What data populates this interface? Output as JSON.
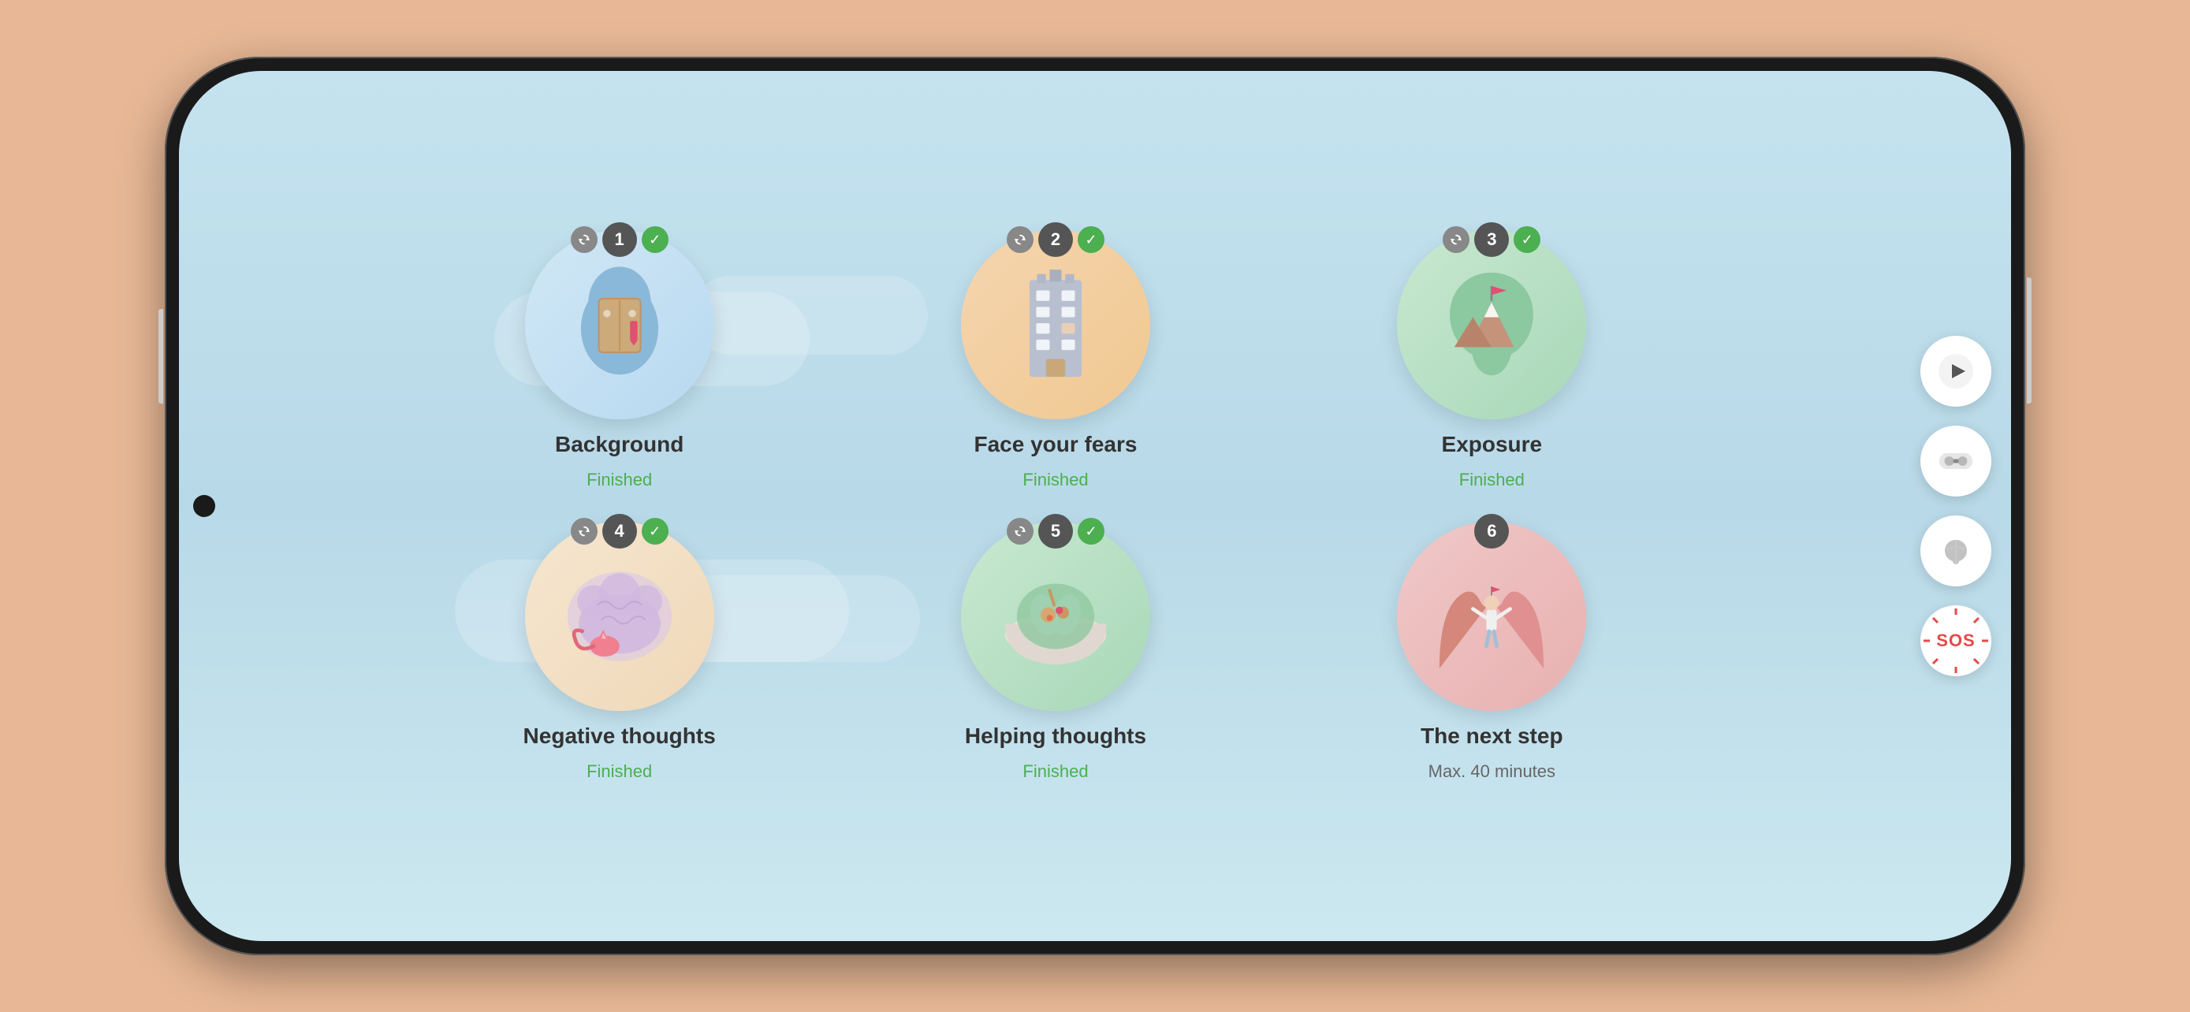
{
  "phone": {
    "background": "#e8b896"
  },
  "modules": [
    {
      "id": 1,
      "number": "1",
      "title": "Background",
      "status": "Finished",
      "statusType": "finished",
      "hasRefresh": true,
      "hasCheck": true,
      "iconType": "head-book",
      "bgType": "blue"
    },
    {
      "id": 2,
      "number": "2",
      "title": "Face your fears",
      "status": "Finished",
      "statusType": "finished",
      "hasRefresh": true,
      "hasCheck": true,
      "iconType": "building",
      "bgType": "orange-bg"
    },
    {
      "id": 3,
      "number": "3",
      "title": "Exposure",
      "status": "Finished",
      "statusType": "finished",
      "hasRefresh": true,
      "hasCheck": true,
      "iconType": "mountain-flag",
      "bgType": "green"
    },
    {
      "id": 4,
      "number": "4",
      "title": "Negative thoughts",
      "status": "Finished",
      "statusType": "finished",
      "hasRefresh": true,
      "hasCheck": true,
      "iconType": "brain-cat",
      "bgType": "beige"
    },
    {
      "id": 5,
      "number": "5",
      "title": "Helping thoughts",
      "status": "Finished",
      "statusType": "finished",
      "hasRefresh": true,
      "hasCheck": true,
      "iconType": "bowl",
      "bgType": "green"
    },
    {
      "id": 6,
      "number": "6",
      "title": "The next step",
      "status": "Max. 40 minutes",
      "statusType": "time",
      "hasRefresh": false,
      "hasCheck": false,
      "iconType": "climber",
      "bgType": "pink"
    }
  ],
  "sidebar": {
    "play_label": "play",
    "vr_label": "vr",
    "brain_label": "brain",
    "sos_label": "SOS"
  }
}
